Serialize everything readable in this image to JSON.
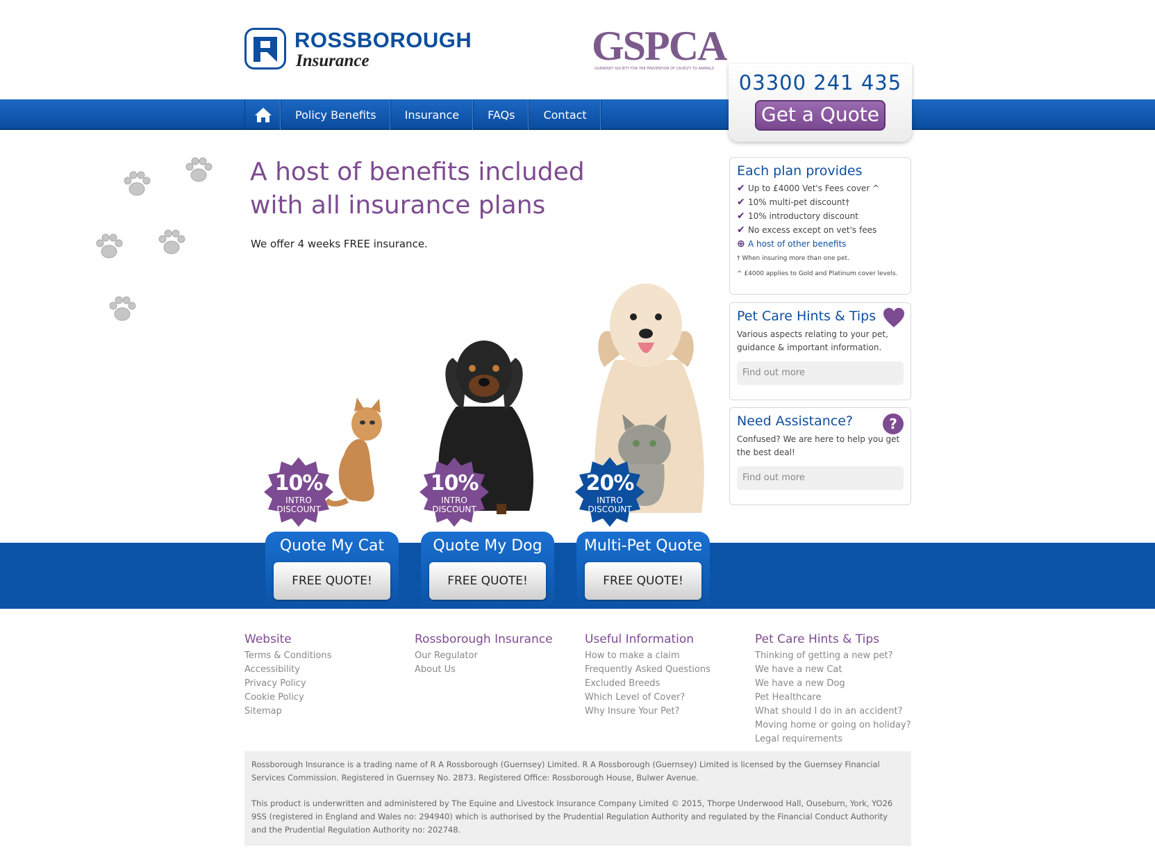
{
  "header": {
    "brand_name": "ROSSBOROUGH",
    "brand_sub": "Insurance",
    "partner_logo_text": "GSPCA",
    "partner_logo_small": "GUERNSEY SOCIETY FOR THE PREVENTION OF CRUELTY TO ANIMALS",
    "phone": "03300 241 435",
    "quote_button": "Get a Quote"
  },
  "nav": {
    "home_icon": "home-icon",
    "items": [
      {
        "label": "Policy Benefits"
      },
      {
        "label": "Insurance"
      },
      {
        "label": "FAQs"
      },
      {
        "label": "Contact"
      }
    ]
  },
  "hero": {
    "title": "A host of benefits included with all insurance plans",
    "subtitle": "We offer 4 weeks FREE insurance."
  },
  "plan_panel": {
    "title": "Each plan provides",
    "items": [
      {
        "text": "Up to £4000 Vet's Fees cover ^"
      },
      {
        "text": "10% multi-pet discount†"
      },
      {
        "text": "10% introductory discount"
      },
      {
        "text": "No excess except on vet's fees"
      }
    ],
    "other": "A host of other benefits",
    "note1": "† When insuring more than one pet.",
    "note2": "^ £4000 applies to Gold and Platinum cover levels."
  },
  "tips_panel": {
    "title": "Pet Care Hints & Tips",
    "body": "Various aspects relating to your pet, guidance & important information.",
    "link": "Find out more"
  },
  "help_panel": {
    "title": "Need Assistance?",
    "body": "Confused? We are here to help you get the best deal!",
    "link": "Find out more",
    "icon_text": "?"
  },
  "badges": [
    {
      "pct": "10%",
      "line1": "INTRO",
      "line2": "DISCOUNT",
      "color": "#7d4b91"
    },
    {
      "pct": "10%",
      "line1": "INTRO",
      "line2": "DISCOUNT",
      "color": "#7d4b91"
    },
    {
      "pct": "20%",
      "line1": "INTRO",
      "line2": "DISCOUNT",
      "color": "#0d4e9e"
    }
  ],
  "quotes": [
    {
      "title": "Quote My Cat",
      "button": "FREE QUOTE!"
    },
    {
      "title": "Quote My Dog",
      "button": "FREE QUOTE!"
    },
    {
      "title": "Multi-Pet Quote",
      "button": "FREE QUOTE!"
    }
  ],
  "footer": {
    "columns": [
      {
        "title": "Website",
        "links": [
          "Terms & Conditions",
          "Accessibility",
          "Privacy Policy",
          "Cookie Policy",
          "Sitemap"
        ]
      },
      {
        "title": "Rossborough Insurance",
        "links": [
          "Our Regulator",
          "About Us"
        ]
      },
      {
        "title": "Useful Information",
        "links": [
          "How to make a claim",
          "Frequently Asked Questions",
          "Excluded Breeds",
          "Which Level of Cover?",
          "Why Insure Your Pet?"
        ]
      },
      {
        "title": "Pet Care Hints & Tips",
        "links": [
          "Thinking of getting a new pet?",
          "We have a new Cat",
          "We have a new Dog",
          "Pet Healthcare",
          "What should I do in an accident?",
          "Moving home or going on holiday?",
          "Legal requirements"
        ]
      }
    ],
    "legal1": "Rossborough Insurance is a trading name of R A Rossborough (Guernsey) Limited. R A Rossborough (Guernsey) Limited is licensed by the Guernsey Financial Services Commission. Registered in Guernsey No. 2873. Registered Office: Rossborough House, Bulwer Avenue.",
    "legal2": "This product is underwritten and administered by The Equine and Livestock Insurance Company Limited © 2015, Thorpe Underwood Hall, Ouseburn, York, YO26 9SS (registered in England and Wales no: 294940) which is authorised by the Prudential Regulation Authority and regulated by the Financial Conduct Authority and the Prudential Regulation Authority no: 202748."
  },
  "colors": {
    "brand_blue": "#0d4e9e",
    "brand_purple": "#7d4b91"
  }
}
